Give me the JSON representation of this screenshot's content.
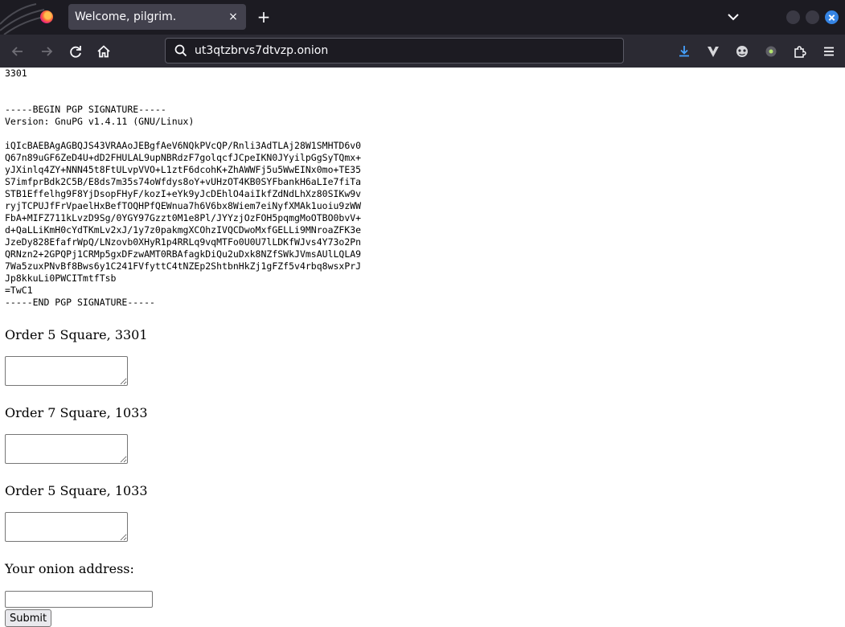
{
  "browser": {
    "tab_title": "Welcome, pilgrim.",
    "tab_close": "×",
    "new_tab": "+",
    "url": "ut3qtzbrvs7dtvzp.onion"
  },
  "page": {
    "top_number": "3301",
    "pgp_signature": "-----BEGIN PGP SIGNATURE-----\nVersion: GnuPG v1.4.11 (GNU/Linux)\n\niQIcBAEBAgAGBQJS43VRAAoJEBgfAeV6NQkPVcQP/Rnli3AdTLAj28W1SMHTD6v0\nQ67n89uGF6ZeD4U+dD2FHULAL9upNBRdzF7golqcfJCpeIKN0JYyilpGgSyTQmx+\nyJXinlq4ZY+NNN45t8FtULvpVVO+L1ztF6dcohK+ZhAWWFj5u5WwEINx0mo+TE35\nS7imfprBdk2C5B/E8ds7m35s74oWfdys8oY+vUHzOT4KB0SYFbankH6aLIe7fiTa\nSTB1Effelhg9F8YjDsopFHyF/kozI+eYk9yJcDEhlO4aiIkfZdNdLhXz80SIKw9v\nryjTCPUJfFrVpaelHxBefTOQHPfQEWnua7h6V6bx8Wiem7eiNyfXMAk1uoiu9zWW\nFbA+MIFZ711kLvzD9Sg/0YGY97Gzzt0M1e8Pl/JYYzjOzFOH5pqmgMoOTBO0bvV+\nd+QaLLiKmH0cYdTKmLv2xJ/1y7z0pakmgXCOhzIVQCDwoMxfGELLi9MNroaZFK3e\nJzeDy828EfafrWpQ/LNzovb0XHyR1p4RRLq9vqMTFo0U0U7lLDKfWJvs4Y73o2Pn\nQRNzn2+2GPQPj1CRMp5gxDFzwAMT0RBAfagkDiQu2uDxk8NZfSWkJVmsAUlLQLA9\n7Wa5zuxPNvBf8Bws6y1C241FVfyttC4tNZEp2ShtbnHkZj1gFZf5v4rbq8wsxPrJ\nJp8kkuLi0PWCITmtfTsb\n=TwC1\n-----END PGP SIGNATURE-----",
    "orders": [
      {
        "label": "Order 5 Square, 3301",
        "value": ""
      },
      {
        "label": "Order 7 Square, 1033",
        "value": ""
      },
      {
        "label": "Order 5 Square, 1033",
        "value": ""
      }
    ],
    "onion_label": "Your onion address:",
    "onion_value": "",
    "submit_label": "Submit"
  }
}
